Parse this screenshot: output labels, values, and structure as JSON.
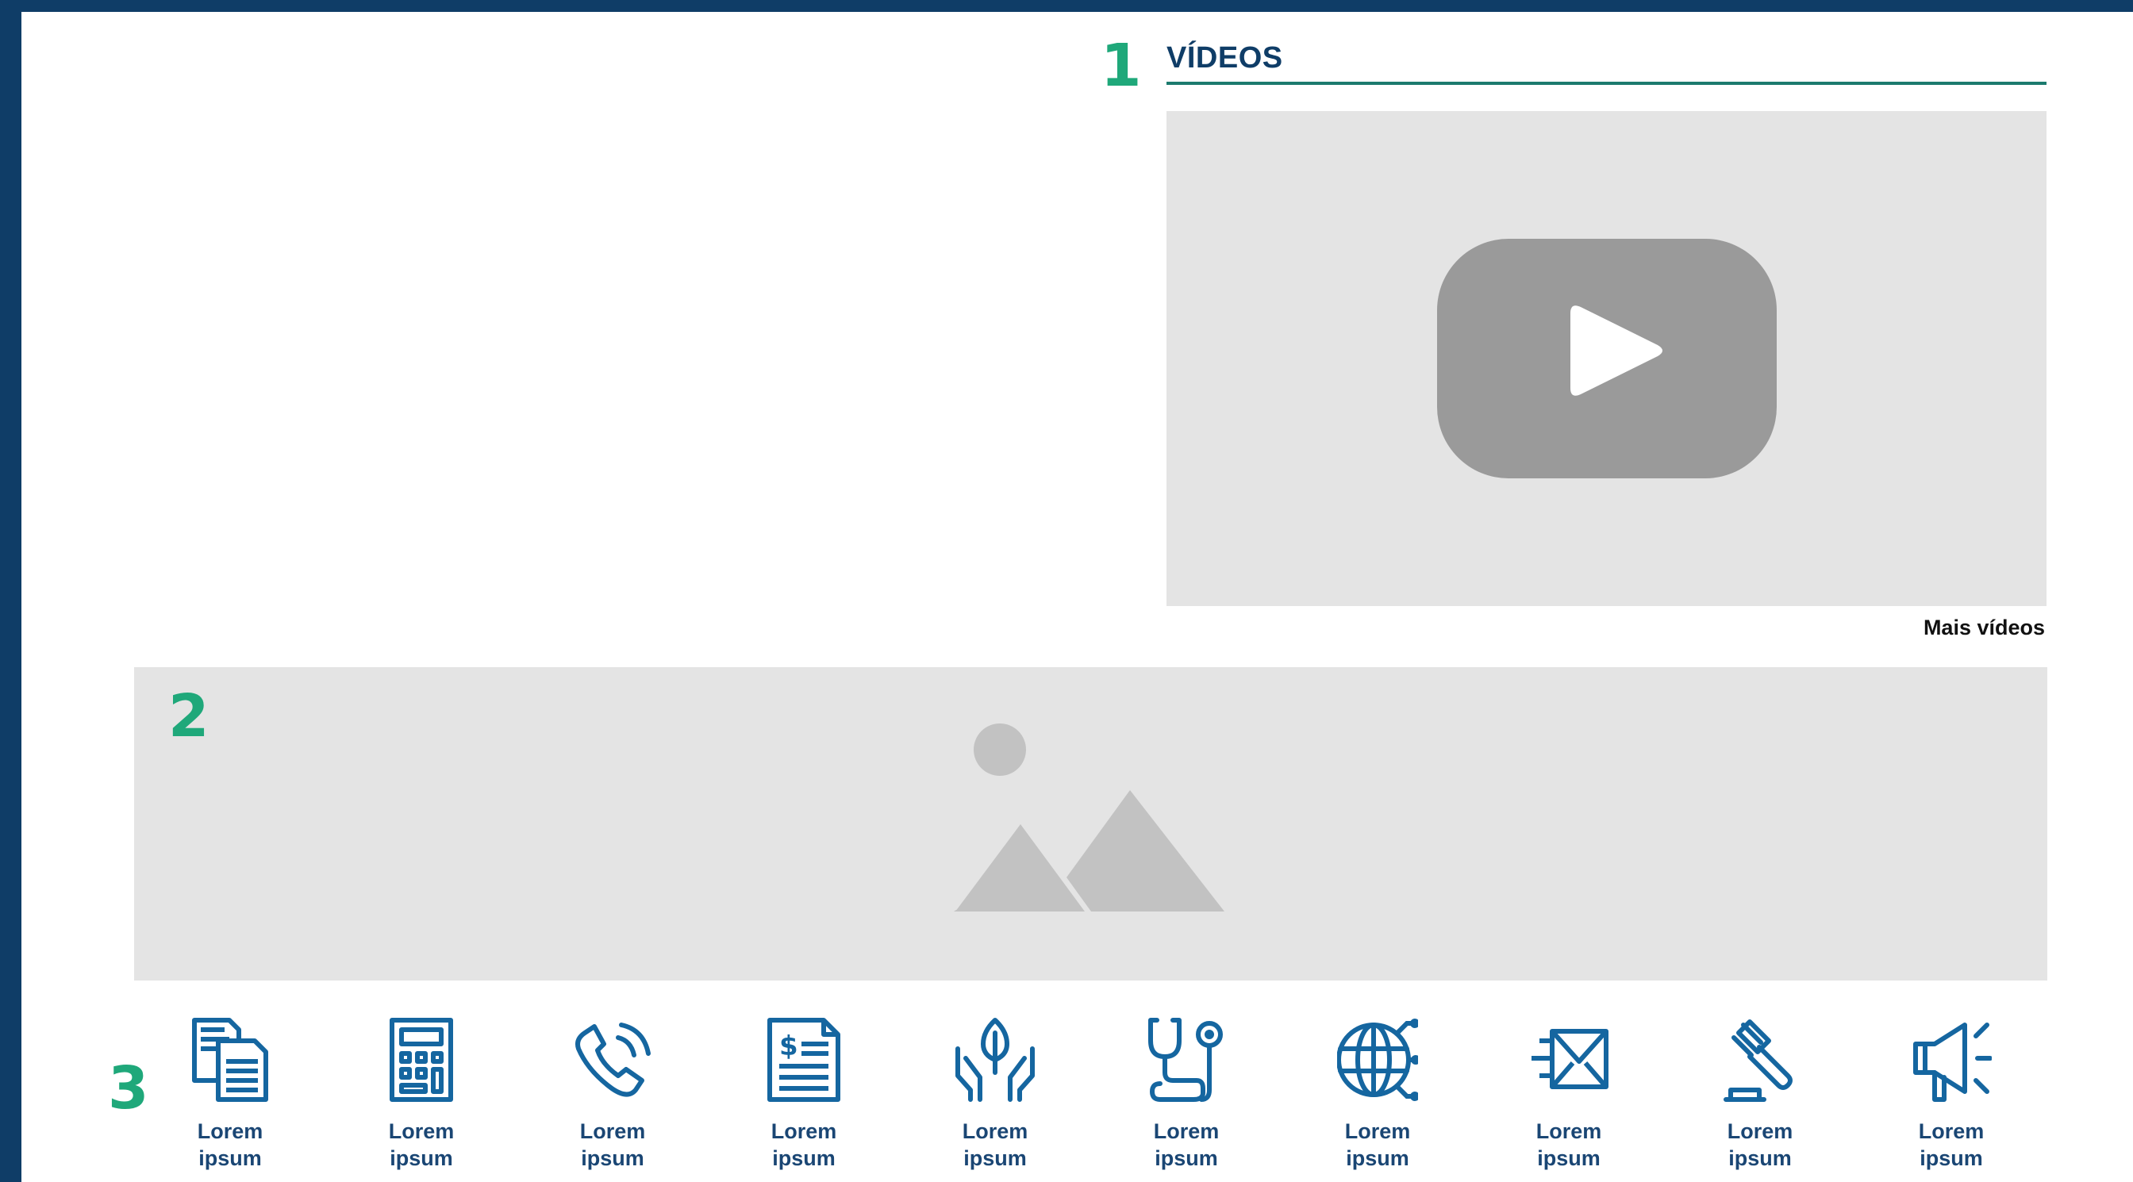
{
  "markers": {
    "one": "1",
    "two": "2",
    "three": "3"
  },
  "videos": {
    "title": "VÍDEOS",
    "more_link": "Mais vídeos"
  },
  "icons": [
    {
      "name": "documents-icon",
      "line1": "Lorem",
      "line2": "ipsum"
    },
    {
      "name": "calculator-icon",
      "line1": "Lorem",
      "line2": "ipsum"
    },
    {
      "name": "phone-icon",
      "line1": "Lorem",
      "line2": "ipsum"
    },
    {
      "name": "invoice-icon",
      "line1": "Lorem",
      "line2": "ipsum"
    },
    {
      "name": "hands-leaf-icon",
      "line1": "Lorem",
      "line2": "ipsum"
    },
    {
      "name": "stethoscope-icon",
      "line1": "Lorem",
      "line2": "ipsum"
    },
    {
      "name": "globe-network-icon",
      "line1": "Lorem",
      "line2": "ipsum"
    },
    {
      "name": "email-fast-icon",
      "line1": "Lorem",
      "line2": "ipsum"
    },
    {
      "name": "gavel-icon",
      "line1": "Lorem",
      "line2": "ipsum"
    },
    {
      "name": "megaphone-icon",
      "line1": "Lorem",
      "line2": "ipsum"
    }
  ],
  "colors": {
    "frame": "#0f3d67",
    "accent_green": "#1fa87a",
    "title_blue": "#0f3d67",
    "icon_blue": "#1566a0",
    "placeholder_bg": "#e4e4e4"
  }
}
